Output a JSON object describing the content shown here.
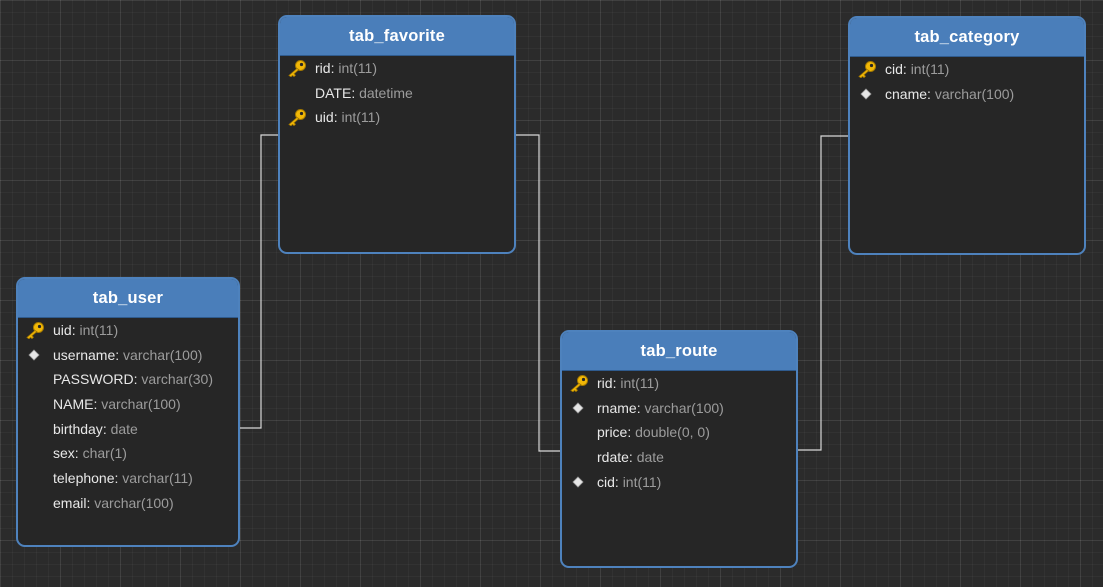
{
  "tables": {
    "tab_favorite": {
      "name": "tab_favorite",
      "fields": [
        {
          "name": "rid",
          "type": "int(11)",
          "marker": "primary-key-icon"
        },
        {
          "name": "DATE",
          "type": "datetime",
          "marker": "none"
        },
        {
          "name": "uid",
          "type": "int(11)",
          "marker": "primary-key-icon"
        }
      ]
    },
    "tab_category": {
      "name": "tab_category",
      "fields": [
        {
          "name": "cid",
          "type": "int(11)",
          "marker": "primary-key-icon"
        },
        {
          "name": "cname",
          "type": "varchar(100)",
          "marker": "unique-diamond-icon"
        }
      ]
    },
    "tab_user": {
      "name": "tab_user",
      "fields": [
        {
          "name": "uid",
          "type": "int(11)",
          "marker": "primary-key-icon"
        },
        {
          "name": "username",
          "type": "varchar(100)",
          "marker": "unique-diamond-icon"
        },
        {
          "name": "PASSWORD",
          "type": "varchar(30)",
          "marker": "none"
        },
        {
          "name": "NAME",
          "type": "varchar(100)",
          "marker": "none"
        },
        {
          "name": "birthday",
          "type": "date",
          "marker": "none"
        },
        {
          "name": "sex",
          "type": "char(1)",
          "marker": "none"
        },
        {
          "name": "telephone",
          "type": "varchar(11)",
          "marker": "none"
        },
        {
          "name": "email",
          "type": "varchar(100)",
          "marker": "none"
        }
      ]
    },
    "tab_route": {
      "name": "tab_route",
      "fields": [
        {
          "name": "rid",
          "type": "int(11)",
          "marker": "primary-key-icon"
        },
        {
          "name": "rname",
          "type": "varchar(100)",
          "marker": "unique-diamond-icon"
        },
        {
          "name": "price",
          "type": "double(0, 0)",
          "marker": "none"
        },
        {
          "name": "rdate",
          "type": "date",
          "marker": "none"
        },
        {
          "name": "cid",
          "type": "int(11)",
          "marker": "unique-diamond-icon"
        }
      ]
    }
  },
  "relationships": [
    {
      "from": "tab_user",
      "to": "tab_favorite"
    },
    {
      "from": "tab_favorite",
      "to": "tab_route"
    },
    {
      "from": "tab_route",
      "to": "tab_category"
    }
  ],
  "colors": {
    "canvas": "#2b2b2b",
    "header": "#4a7eba",
    "border": "#4e82bd",
    "body": "#262626",
    "field_name": "#e8e8e8",
    "field_type": "#9c9c9c",
    "key": "#f2b807",
    "connector": "#d8d8d8"
  }
}
